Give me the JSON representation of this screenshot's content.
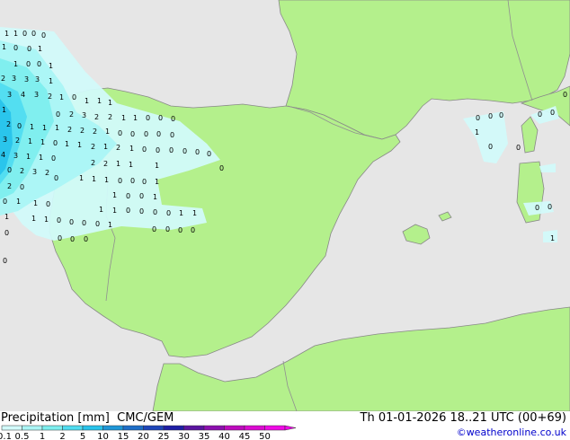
{
  "product": {
    "parameter": "Precipitation [mm]",
    "model": "CMC/GEM",
    "valid_time": "Th 01-01-2026 18..21 UTC (00+69)",
    "credit": "©weatheronline.co.uk"
  },
  "colors": {
    "sea": "#e6e6e6",
    "land": "#b4f08c",
    "coast": "#888888",
    "border": "#909090"
  },
  "legend": {
    "labels": [
      "0.1",
      "0.5",
      "1",
      "2",
      "5",
      "10",
      "15",
      "20",
      "25",
      "30",
      "35",
      "40",
      "45",
      "50"
    ],
    "colors": [
      "#d2fafa",
      "#aaf5f5",
      "#7deeee",
      "#50dcf0",
      "#28c3eb",
      "#1e96d7",
      "#1e6ec8",
      "#1e46b9",
      "#1e1ea5",
      "#5a14a0",
      "#8c0faf",
      "#be0abe",
      "#dc0ad2",
      "#f00ae6"
    ]
  },
  "precip_values": [
    "1",
    "1",
    "0",
    "0",
    "0",
    "1",
    "0",
    "0",
    "1",
    "1",
    "0",
    "0",
    "1",
    "2",
    "3",
    "3",
    "3",
    "1",
    "3",
    "4",
    "3",
    "2",
    "1",
    "0",
    "1",
    "1",
    "1",
    "1",
    "0",
    "2",
    "3",
    "2",
    "2",
    "1",
    "1",
    "0",
    "0",
    "0",
    "0",
    "0",
    "2",
    "0",
    "1",
    "1",
    "1",
    "2",
    "2",
    "2",
    "1",
    "0",
    "0",
    "0",
    "0",
    "0",
    "3",
    "2",
    "1",
    "1",
    "0",
    "1",
    "1",
    "2",
    "1",
    "2",
    "1",
    "0",
    "0",
    "0",
    "0",
    "0",
    "0",
    "0",
    "4",
    "3",
    "1",
    "1",
    "0",
    "2",
    "2",
    "1",
    "1",
    "1",
    "0",
    "2",
    "3",
    "2",
    "1",
    "1",
    "1",
    "0",
    "0",
    "0",
    "1",
    "2",
    "0",
    "1",
    "0",
    "0",
    "1",
    "1",
    "0",
    "1",
    "1",
    "0",
    "0",
    "0",
    "0",
    "1",
    "1",
    "1",
    "1",
    "1",
    "0",
    "0",
    "0",
    "0",
    "1",
    "0",
    "0",
    "0",
    "0",
    "0",
    "0",
    "0",
    "0",
    "0",
    "0",
    "1",
    "1",
    "0",
    "0",
    "0",
    "0",
    "0",
    "0",
    "0",
    "0",
    "1",
    "0"
  ]
}
